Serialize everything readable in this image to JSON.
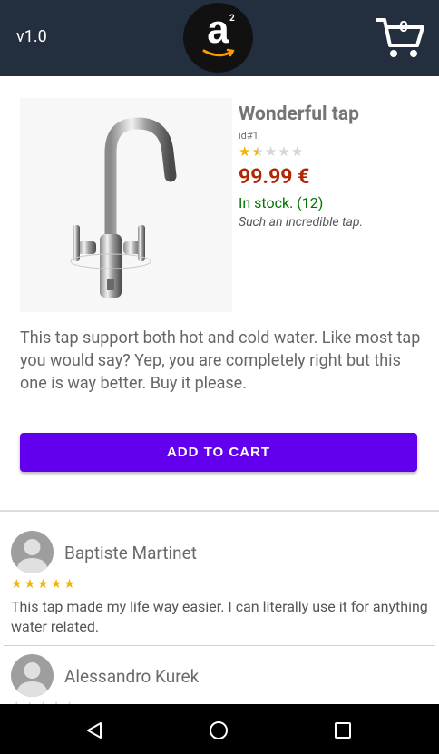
{
  "appbar": {
    "version": "v1.0",
    "logo_letter": "a",
    "logo_superscript": "2",
    "cart_count": "0"
  },
  "product": {
    "title": "Wonderful tap",
    "id": "id#1",
    "rating": 1.5,
    "rating_max": 5,
    "price": "99.99 €",
    "stock": "In stock. (12)",
    "tagline": "Such an incredible tap.",
    "description": "This tap support both hot and cold water. Like most tap you would say? Yep, you are completely right but this one is way better. Buy it please.",
    "add_to_cart_label": "ADD TO CART"
  },
  "reviews": [
    {
      "author": "Baptiste Martinet",
      "rating": 5,
      "text": "This tap made my life way easier. I can literally use it for anything water related."
    },
    {
      "author": "Alessandro Kurek",
      "rating": 0,
      "text": ""
    }
  ],
  "colors": {
    "appbar": "#232f3e",
    "accent": "#6200ee",
    "price": "#b12704",
    "in_stock": "#007600",
    "star": "#f4b400",
    "logo_smile": "#ff9900"
  },
  "icons": {
    "logo": "amazon-logo-icon",
    "cart": "shopping-cart-icon",
    "back": "back-triangle-icon",
    "home": "home-circle-icon",
    "recents": "recents-square-icon"
  }
}
